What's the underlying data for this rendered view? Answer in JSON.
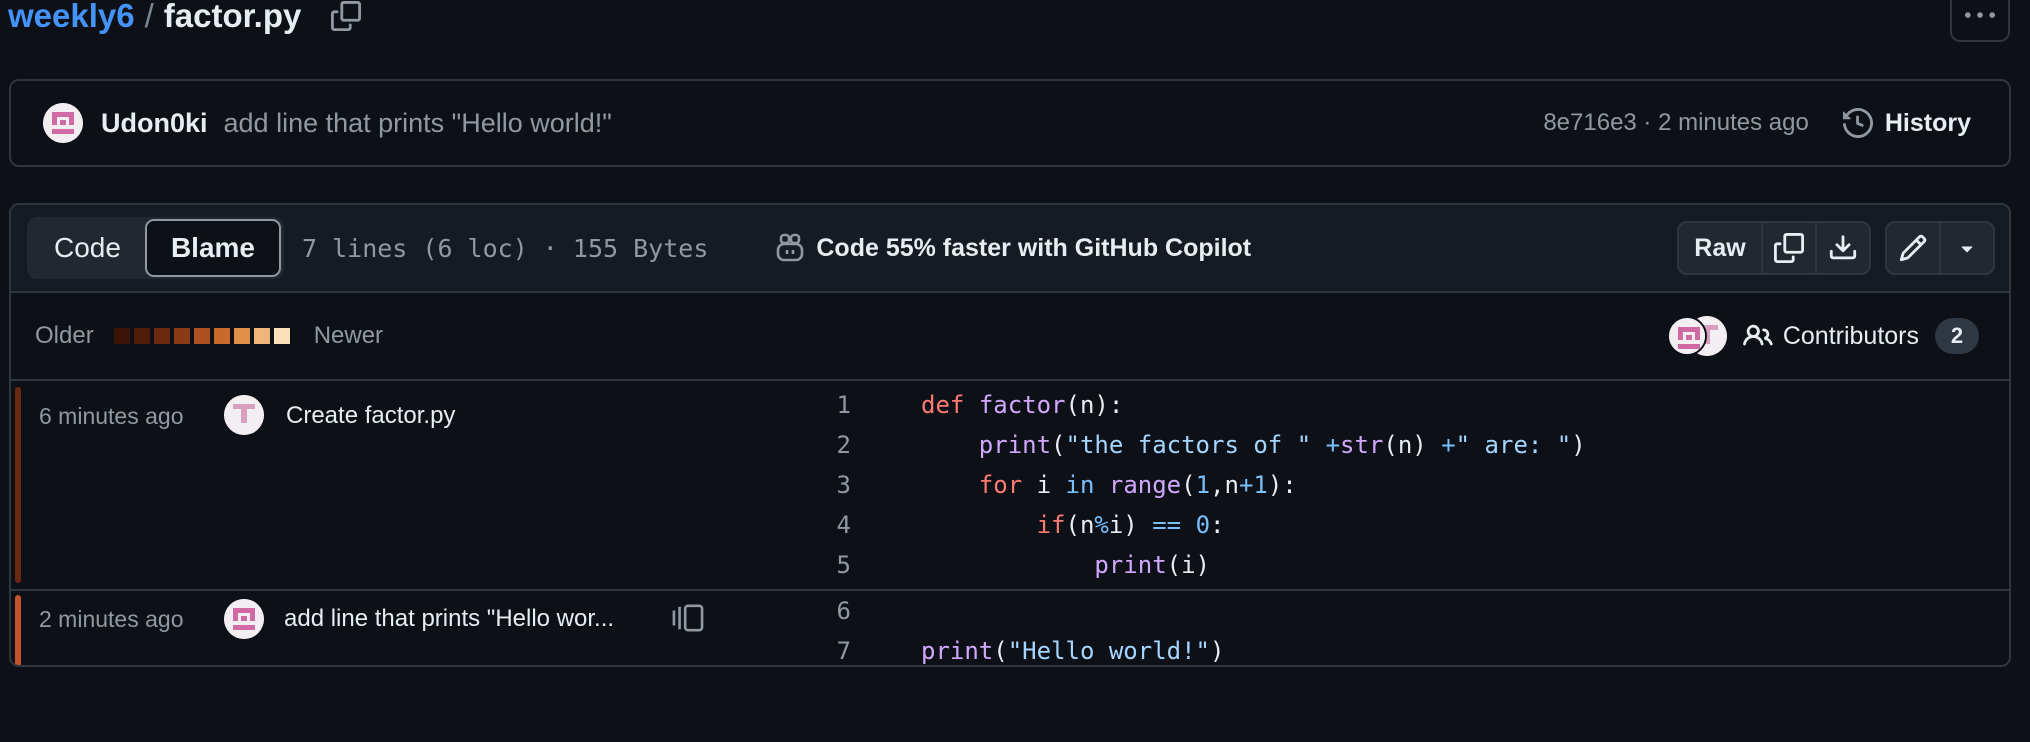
{
  "breadcrumb": {
    "repo": "weekly6",
    "separator": "/",
    "file": "factor.py"
  },
  "latest_commit": {
    "author": "Udon0ki",
    "message": "add line that prints \"Hello world!\"",
    "meta": "8e716e3 · 2 minutes ago",
    "history_label": "History"
  },
  "file_header": {
    "tab_code": "Code",
    "tab_blame": "Blame",
    "stats": "7 lines (6 loc) · 155 Bytes",
    "copilot": "Code 55% faster with GitHub Copilot",
    "raw_label": "Raw"
  },
  "legend": {
    "older": "Older",
    "newer": "Newer",
    "colors": [
      "#3a1406",
      "#4f1d0a",
      "#6b2a0f",
      "#8a3b16",
      "#ad4f1e",
      "#c96a2d",
      "#e08f4a",
      "#f0b57a",
      "#fbe0b8"
    ],
    "contributors_label": "Contributors",
    "contributors_count": "2"
  },
  "hunks": [
    {
      "time": "6 minutes ago",
      "message": "Create factor.py",
      "bar_color": "#6b2a0f",
      "lines": [
        {
          "n": "1",
          "code": "def factor(n):"
        },
        {
          "n": "2",
          "code": "    print(\"the factors of \" +str(n) +\" are: \")"
        },
        {
          "n": "3",
          "code": "    for i in range(1,n+1):"
        },
        {
          "n": "4",
          "code": "        if(n%i) == 0:"
        },
        {
          "n": "5",
          "code": "            print(i)"
        }
      ]
    },
    {
      "time": "2 minutes ago",
      "message": "add line that prints \"Hello wor...",
      "bar_color": "#c0542a",
      "lines": [
        {
          "n": "6",
          "code": ""
        },
        {
          "n": "7",
          "code": "print(\"Hello world!\")"
        }
      ]
    }
  ],
  "icons": [
    "copy-icon",
    "kebab-icon",
    "avatar",
    "history-icon",
    "copilot-icon",
    "copy-icon",
    "download-icon",
    "pencil-icon",
    "triangle-down-icon",
    "people-icon",
    "reblame-icon"
  ]
}
